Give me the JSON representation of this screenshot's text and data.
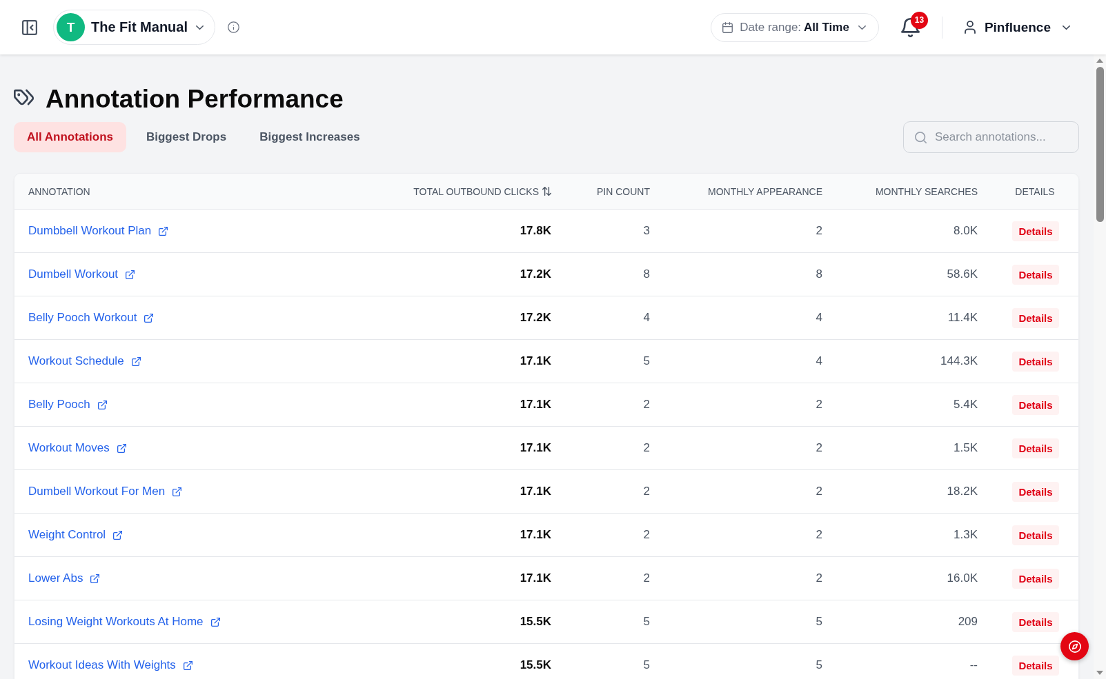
{
  "top_bar": {
    "workspace": {
      "initial": "T",
      "name": "The Fit Manual"
    },
    "date_range": {
      "label": "Date range:",
      "value": "All Time"
    },
    "notifications": {
      "count": "13"
    },
    "user": {
      "name": "Pinfluence"
    }
  },
  "page_title": "Annotation Performance",
  "tabs": [
    {
      "label": "All Annotations",
      "selected": true
    },
    {
      "label": "Biggest Drops",
      "selected": false
    },
    {
      "label": "Biggest Increases",
      "selected": false
    }
  ],
  "search": {
    "placeholder": "Search annotations..."
  },
  "table": {
    "columns": [
      {
        "label": "ANNOTATION",
        "sortable": false
      },
      {
        "label": "TOTAL OUTBOUND CLICKS",
        "sortable": true
      },
      {
        "label": "PIN COUNT",
        "sortable": false
      },
      {
        "label": "MONTHLY APPEARANCE",
        "sortable": false
      },
      {
        "label": "MONTHLY SEARCHES",
        "sortable": false
      },
      {
        "label": "DETAILS",
        "sortable": false
      }
    ],
    "rows": [
      {
        "annotation": "Dumbbell Workout Plan",
        "total_outbound_clicks": "17.8K",
        "pin_count": "3",
        "monthly_appearance": "2",
        "monthly_searches": "8.0K",
        "details": "Details"
      },
      {
        "annotation": "Dumbell Workout",
        "total_outbound_clicks": "17.2K",
        "pin_count": "8",
        "monthly_appearance": "8",
        "monthly_searches": "58.6K",
        "details": "Details"
      },
      {
        "annotation": "Belly Pooch Workout",
        "total_outbound_clicks": "17.2K",
        "pin_count": "4",
        "monthly_appearance": "4",
        "monthly_searches": "11.4K",
        "details": "Details"
      },
      {
        "annotation": "Workout Schedule",
        "total_outbound_clicks": "17.1K",
        "pin_count": "5",
        "monthly_appearance": "4",
        "monthly_searches": "144.3K",
        "details": "Details"
      },
      {
        "annotation": "Belly Pooch",
        "total_outbound_clicks": "17.1K",
        "pin_count": "2",
        "monthly_appearance": "2",
        "monthly_searches": "5.4K",
        "details": "Details"
      },
      {
        "annotation": "Workout Moves",
        "total_outbound_clicks": "17.1K",
        "pin_count": "2",
        "monthly_appearance": "2",
        "monthly_searches": "1.5K",
        "details": "Details"
      },
      {
        "annotation": "Dumbell Workout For Men",
        "total_outbound_clicks": "17.1K",
        "pin_count": "2",
        "monthly_appearance": "2",
        "monthly_searches": "18.2K",
        "details": "Details"
      },
      {
        "annotation": "Weight Control",
        "total_outbound_clicks": "17.1K",
        "pin_count": "2",
        "monthly_appearance": "2",
        "monthly_searches": "1.3K",
        "details": "Details"
      },
      {
        "annotation": "Lower Abs",
        "total_outbound_clicks": "17.1K",
        "pin_count": "2",
        "monthly_appearance": "2",
        "monthly_searches": "16.0K",
        "details": "Details"
      },
      {
        "annotation": "Losing Weight Workouts At Home",
        "total_outbound_clicks": "15.5K",
        "pin_count": "5",
        "monthly_appearance": "5",
        "monthly_searches": "209",
        "details": "Details"
      },
      {
        "annotation": "Workout Ideas With Weights",
        "total_outbound_clicks": "15.5K",
        "pin_count": "5",
        "monthly_appearance": "5",
        "monthly_searches": "--",
        "details": "Details"
      }
    ]
  }
}
